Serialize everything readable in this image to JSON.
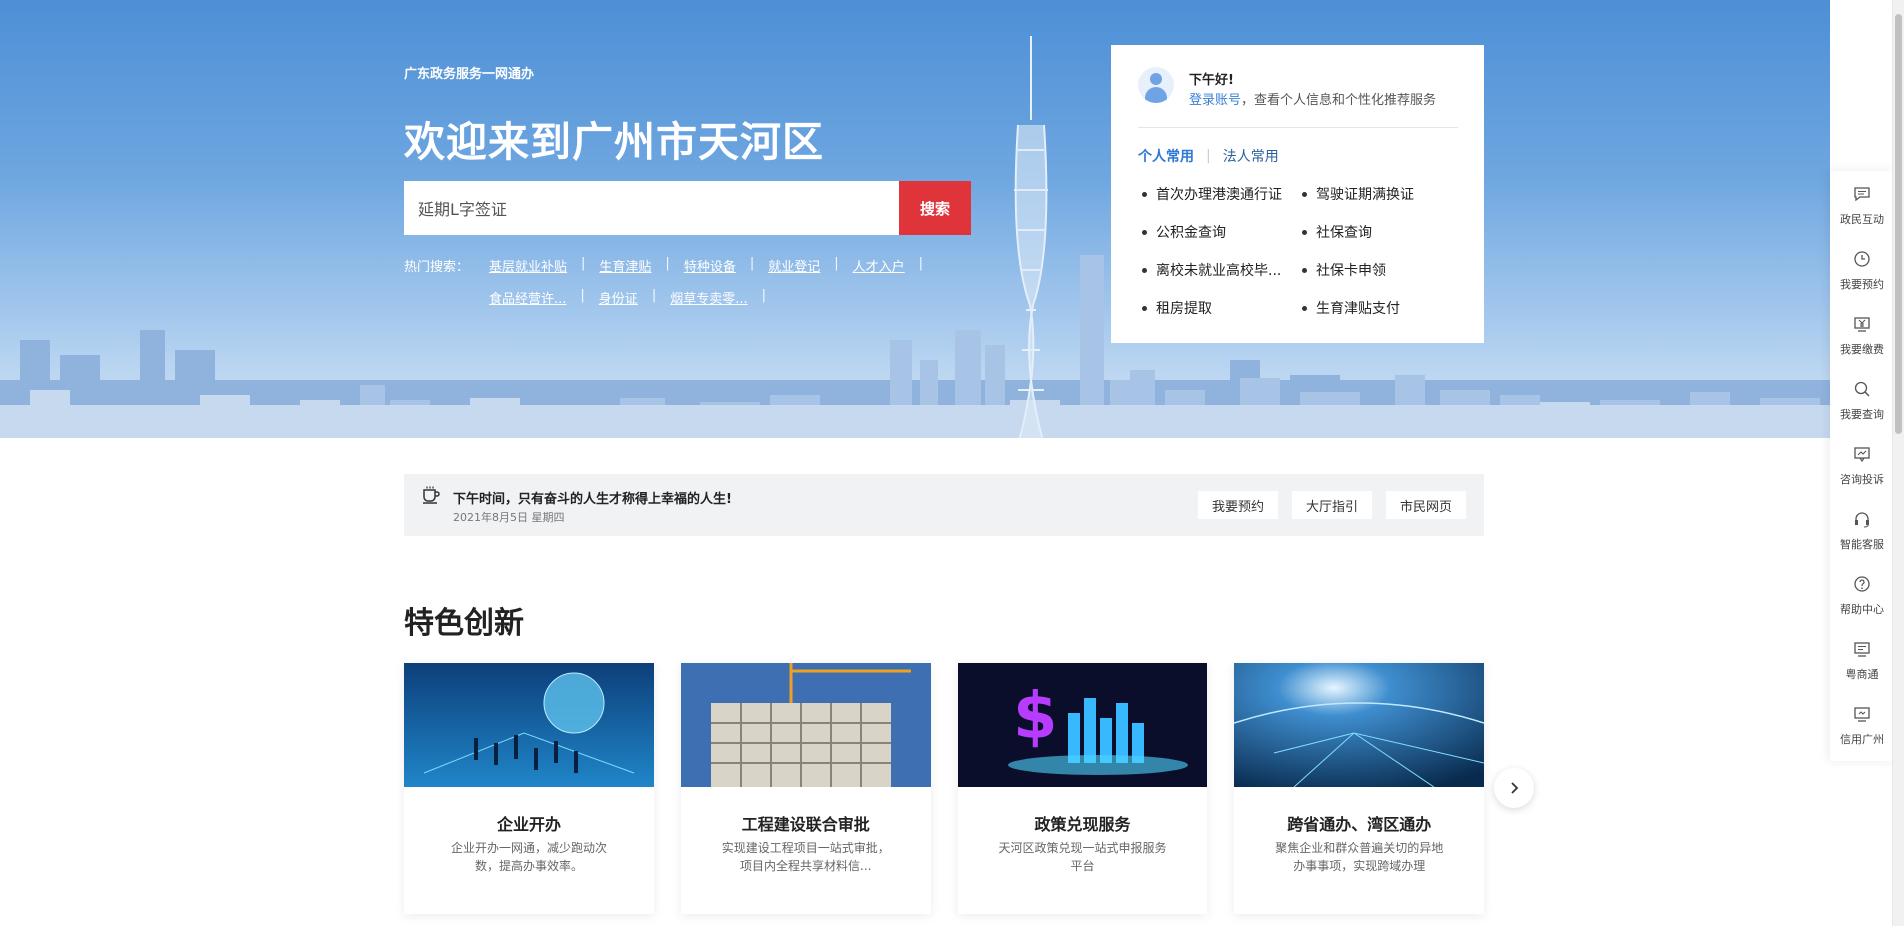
{
  "hero": {
    "subtitle": "广东政务服务一网通办",
    "title": "欢迎来到广州市天河区",
    "search_value": "延期L字签证",
    "search_button": "搜索",
    "hot_label": "热门搜索：",
    "hot_row1": [
      "基层就业补贴",
      "生育津贴",
      "特种设备",
      "就业登记",
      "人才入户"
    ],
    "hot_row2": [
      "食品经营许...",
      "身份证",
      "烟草专卖零..."
    ]
  },
  "login_card": {
    "greeting": "下午好!",
    "login_link": "登录账号",
    "login_rest": "，查看个人信息和个性化推荐服务",
    "tab_personal": "个人常用",
    "tab_legal": "法人常用",
    "services": [
      "首次办理港澳通行证",
      "驾驶证期满换证",
      "公积金查询",
      "社保查询",
      "离校未就业高校毕...",
      "社保卡申领",
      "租房提取",
      "生育津贴支付"
    ]
  },
  "notice": {
    "title": "下午时间，只有奋斗的人生才称得上幸福的人生!",
    "date": "2021年8月5日 星期四",
    "buttons": [
      "我要预约",
      "大厅指引",
      "市民网页"
    ]
  },
  "section_title": "特色创新",
  "cards": [
    {
      "title": "企业开办",
      "desc": "企业开办一网通，减少跑动次数，提高办事效率。"
    },
    {
      "title": "工程建设联合审批",
      "desc": "实现建设工程项目一站式审批，项目内全程共享材料信..."
    },
    {
      "title": "政策兑现服务",
      "desc": "天河区政策兑现一站式申报服务平台"
    },
    {
      "title": "跨省通办、湾区通办",
      "desc": "聚焦企业和群众普遍关切的异地办事事项，实现跨域办理"
    }
  ],
  "sidebar": [
    {
      "label": "政民互动",
      "icon": "chat-icon"
    },
    {
      "label": "我要预约",
      "icon": "clock-icon"
    },
    {
      "label": "我要缴费",
      "icon": "yuan-icon"
    },
    {
      "label": "我要查询",
      "icon": "search-icon"
    },
    {
      "label": "咨询投诉",
      "icon": "message-icon"
    },
    {
      "label": "智能客服",
      "icon": "headset-icon"
    },
    {
      "label": "帮助中心",
      "icon": "help-icon"
    },
    {
      "label": "粤商通",
      "icon": "card-icon"
    },
    {
      "label": "信用广州",
      "icon": "credit-icon"
    }
  ]
}
